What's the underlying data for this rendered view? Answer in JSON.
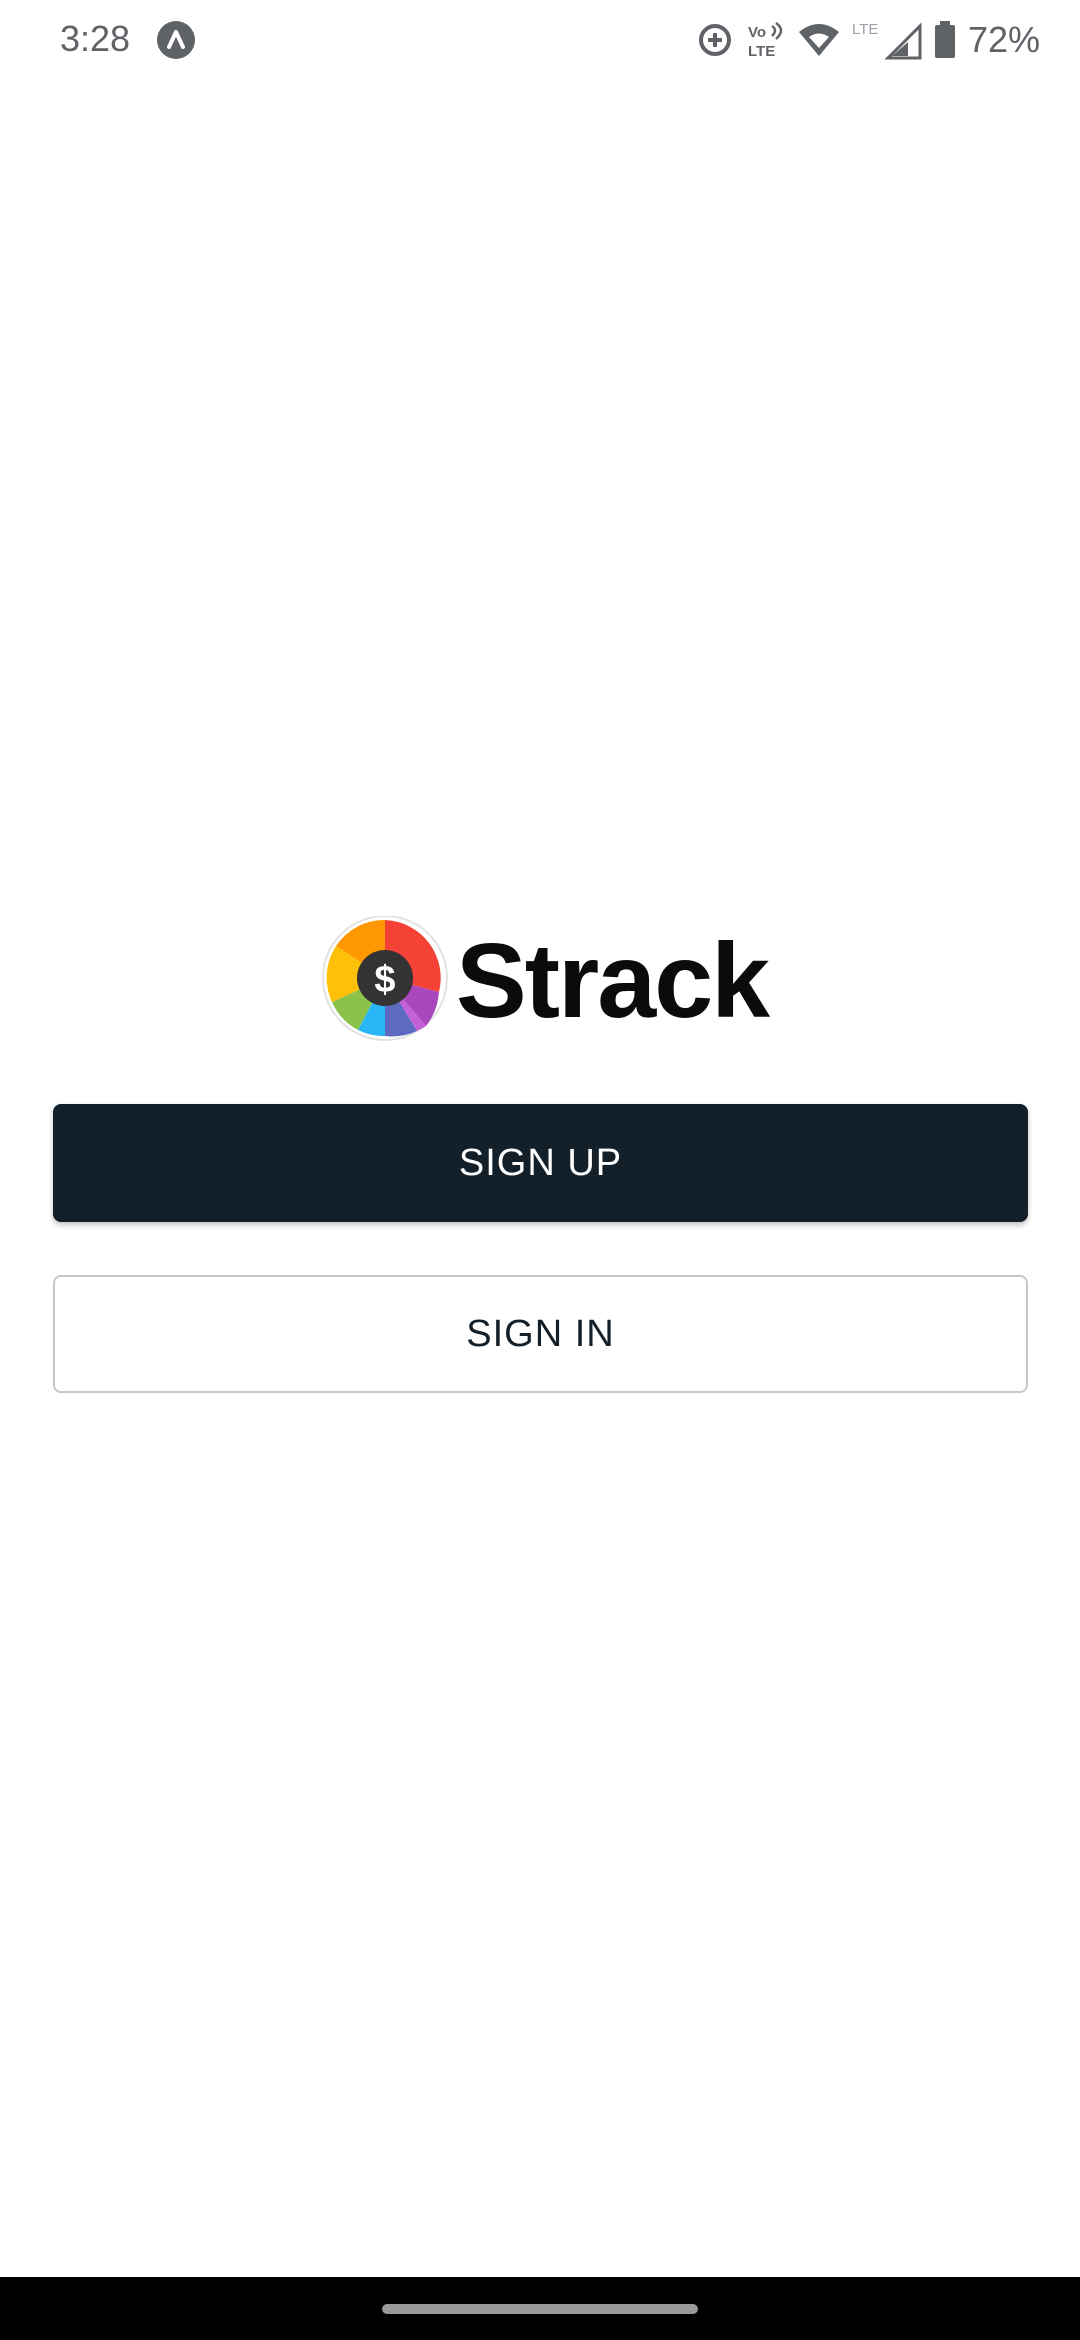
{
  "status_bar": {
    "time": "3:28",
    "app_icon": "caret-up-badge-icon",
    "icons": [
      "data-saver-icon",
      "volte-icon",
      "wifi-icon",
      "lte-signal-icon",
      "battery-icon"
    ],
    "volte_label_top": "Vo",
    "volte_label_bottom": "LTE",
    "lte_label": "LTE",
    "battery": "72%"
  },
  "app": {
    "name": "Strack",
    "logo_symbol": "$",
    "logo_colors": [
      "#f4433c",
      "#ff9800",
      "#ffc107",
      "#8bc34a",
      "#03a9f4",
      "#3f51b5",
      "#9c27b0"
    ]
  },
  "actions": {
    "sign_up": "SIGN UP",
    "sign_in": "SIGN IN"
  },
  "colors": {
    "primary": "#13202a",
    "background": "#ffffff"
  }
}
